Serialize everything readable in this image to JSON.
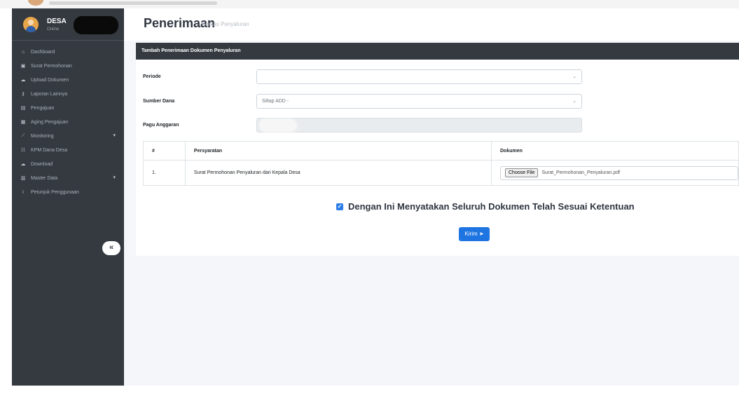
{
  "sidebar": {
    "user_name": "DESA",
    "user_status": "Online",
    "items": [
      {
        "icon": "home-icon",
        "glyph": "⌂",
        "label": "Dashboard"
      },
      {
        "icon": "document-icon",
        "glyph": "▣",
        "label": "Surat Permohonan"
      },
      {
        "icon": "cloud-upload-icon",
        "glyph": "☁",
        "label": "Upload Dokumen"
      },
      {
        "icon": "key-icon",
        "glyph": "⚷",
        "label": "Laporan Lainnya"
      },
      {
        "icon": "money-icon",
        "glyph": "▤",
        "label": "Pengajuan"
      },
      {
        "icon": "calendar-icon",
        "glyph": "▦",
        "label": "Aging Pengajuan"
      },
      {
        "icon": "chart-icon",
        "glyph": "⟋",
        "label": "Monitoring",
        "has_submenu": true
      },
      {
        "icon": "users-icon",
        "glyph": "☷",
        "label": "KPM Dana Desa"
      },
      {
        "icon": "cloud-download-icon",
        "glyph": "☁",
        "label": "Download"
      },
      {
        "icon": "database-icon",
        "glyph": "▥",
        "label": "Master Data",
        "has_submenu": true
      },
      {
        "icon": "info-icon",
        "glyph": "i",
        "label": "Petunjuk Penggunaan"
      }
    ],
    "collapse_glyph": "«"
  },
  "header": {
    "title": "Penerimaan",
    "subtitle": "Berkas Penyaluran"
  },
  "form": {
    "card_title": "Tambah Penerimaan Dokumen Penyaluran",
    "periode_label": "Periode",
    "periode_value": "",
    "sumber_label": "Sumber Dana",
    "sumber_value": "Siltap ADD -",
    "pagu_label": "Pagu Anggaran"
  },
  "table": {
    "headers": [
      "#",
      "Persyaratan",
      "Dokumen"
    ],
    "rows": [
      {
        "no": "1.",
        "persyaratan": "Surat Permohonan Penyaluran dari Kepala Desa",
        "file_button": "Choose File",
        "file_name": "Surat_Permohonan_Penyaluran.pdf"
      }
    ]
  },
  "agreement": {
    "checked": true,
    "text": "Dengan Ini Menyatakan Seluruh Dokumen Telah Sesuai Ketentuan"
  },
  "submit": {
    "label": "Kirim",
    "icon": "send-icon"
  },
  "colors": {
    "sidebar": "#343a40",
    "accent": "#1e74e0",
    "card_header": "#343a40",
    "background": "#f4f6f9"
  }
}
